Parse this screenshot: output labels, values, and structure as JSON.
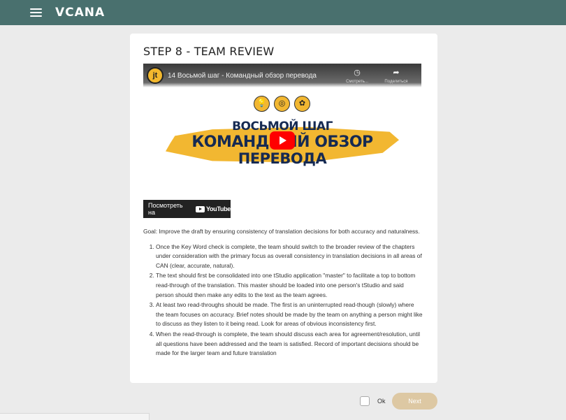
{
  "header": {
    "logo": "VCANA",
    "menu_icon": "hamburger-icon"
  },
  "step": {
    "title": "STEP 8 - TEAM REVIEW"
  },
  "video": {
    "title": "14 Восьмой шаг - Командный обзор перевода",
    "channel_icon": "jt",
    "actions": [
      {
        "icon": "clock-icon",
        "label": "Смотреть..."
      },
      {
        "icon": "share-icon",
        "label": "Поделиться"
      }
    ],
    "badges": [
      "lightbulb-icon",
      "target-icon",
      "flower-icon"
    ],
    "banner": {
      "line1": "ВОСЬМОЙ ШАГ",
      "line2": "КОМАНДНЫЙ ОБЗОР",
      "line3": "ПЕРЕВОДА"
    },
    "watch_on": "Посмотреть на",
    "youtube": "YouTube",
    "accent": "#f2b731"
  },
  "content": {
    "goal": "Goal: Improve the draft by ensuring consistency of translation decisions for both accuracy and naturalness.",
    "items": [
      "Once the Key Word check is complete, the team should switch to the broader review of the chapters under consideration with the primary focus as overall consistency in translation decisions in all areas of CAN (clear, accurate, natural).",
      "The text should first be consolidated into one tStudio application \"master\" to facilitate a top to bottom read-through of the translation. This master should be loaded into one person's tStudio and said person should then make any edits to the text as the team agrees.",
      "At least two read-throughs should be made. The first is an uninterrupted read-though (slowly) where the team focuses on accuracy. Brief notes should be made by the team on anything a person might like to discuss as they listen to it being read. Look for areas of obvious inconsistency first.",
      "When the read-through is complete, the team should discuss each area for agreement/resolution, until all questions have been addressed and the team is satisfied. Record of important decisions should be made for the larger team and future translation"
    ]
  },
  "footer": {
    "ok_label": "Ok",
    "next_label": "Next",
    "next_color": "#ddc8a3"
  }
}
